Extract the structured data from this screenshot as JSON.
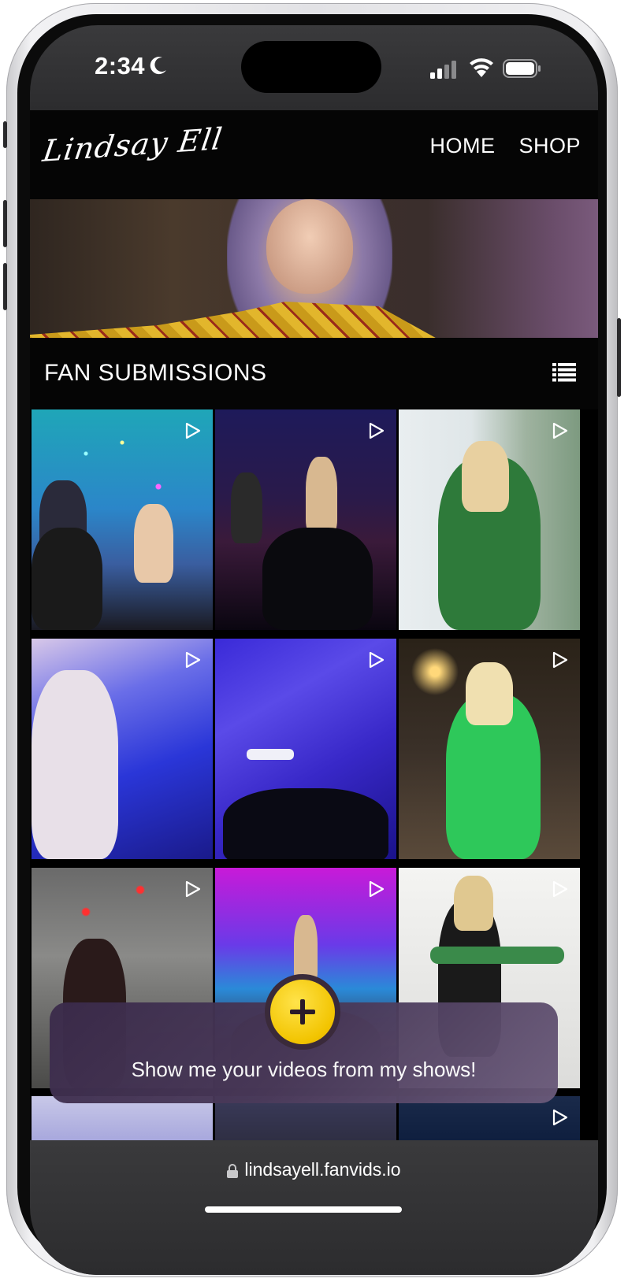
{
  "status_bar": {
    "time": "2:34",
    "icons": [
      "moon-icon",
      "signal-icon",
      "wifi-icon",
      "battery-icon"
    ]
  },
  "site": {
    "logo_text": "Lindsay Ell",
    "nav": [
      {
        "label": "HOME"
      },
      {
        "label": "SHOP"
      }
    ]
  },
  "section": {
    "title": "FAN SUBMISSIONS",
    "view_icon": "list-icon"
  },
  "videos": [
    {
      "thumb": "concert-stage-colorful-lights"
    },
    {
      "thumb": "acoustic-stage-purple"
    },
    {
      "thumb": "acoustic-guitar-green-sweater"
    },
    {
      "thumb": "singer-blue-light"
    },
    {
      "thumb": "guitar-neck-blue-light"
    },
    {
      "thumb": "electric-guitar-green-top"
    },
    {
      "thumb": "stage-red-lights"
    },
    {
      "thumb": "festival-stage-neon"
    },
    {
      "thumb": "floral-guitar-studio"
    },
    {
      "thumb": "partial-row"
    },
    {
      "thumb": "partial-row"
    },
    {
      "thumb": "partial-row"
    }
  ],
  "upload_prompt": {
    "text": "Show me your videos from my shows!",
    "button_icon": "plus-icon"
  },
  "browser": {
    "url": "lindsayell.fanvids.io"
  },
  "colors": {
    "accent_yellow": "#f2c400",
    "background": "#000000"
  }
}
